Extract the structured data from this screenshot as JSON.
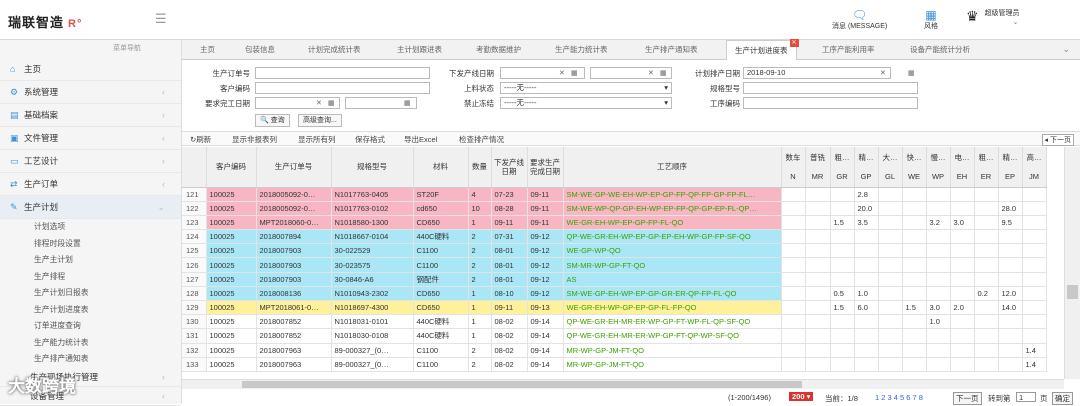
{
  "app": {
    "logo": "瑞联智造",
    "logo_mark": "R°"
  },
  "header": {
    "message": "消息 (MESSAGE)",
    "theme": "风格",
    "user": "超级管理员"
  },
  "sidebar": {
    "top_label": "菜单导航",
    "items": [
      {
        "label": "主页",
        "icon": "home-icon"
      },
      {
        "label": "系统管理",
        "icon": "gears-icon"
      },
      {
        "label": "基础档案",
        "icon": "archive-icon"
      },
      {
        "label": "文件管理",
        "icon": "file-icon"
      },
      {
        "label": "工艺设计",
        "icon": "design-icon"
      },
      {
        "label": "生产订单",
        "icon": "order-icon"
      },
      {
        "label": "生产计划",
        "icon": "plan-icon"
      }
    ],
    "sub_items": [
      "计划选项",
      "排程时段设置",
      "生产主计划",
      "生产排程",
      "生产计划日报表",
      "生产计划进度表",
      "订单进度查询",
      "生产能力统计表",
      "生产排产通知表"
    ],
    "bottom_items": [
      "生产现场执行管理",
      "设备管理"
    ],
    "watermark": "大数跨境"
  },
  "tabs": [
    "主页",
    "包装信息",
    "计划完成统计表",
    "主计划跟进表",
    "考勤数据维护",
    "生产能力统计表",
    "生产排产通知表",
    "生产计划进度表",
    "工序产能利用率",
    "设备产能统计分析"
  ],
  "form": {
    "order_no_label": "生产订单号",
    "customer_code_label": "客户编码",
    "required_date_label": "要求完工日期",
    "issue_date_label": "下发产线日期",
    "line_status_label": "上料状态",
    "line_status_value": "-----无-----",
    "forbid_label": "禁止冻结",
    "forbid_value": "-----无-----",
    "plan_date_label": "计划排产日期",
    "plan_date_value": "2018-09-10",
    "spec_label": "规格型号",
    "process_code_label": "工序编码",
    "query": "查询",
    "advanced": "高级查询..."
  },
  "toolbar": [
    "刷新",
    "显示非报表列",
    "显示所有列",
    "保存格式",
    "导出Excel",
    "检查排产情况"
  ],
  "toolbar_right": "下一页",
  "table": {
    "headers": [
      "客户编码",
      "生产订单号",
      "规格型号",
      "材料",
      "数量",
      "下发产线日期",
      "要求生产完成日期",
      "工艺顺序",
      "数车",
      "普铣",
      "粗…",
      "精…",
      "大…",
      "快…",
      "慢…",
      "电…",
      "粗…",
      "精…",
      "高…"
    ],
    "subheaders": [
      "",
      "",
      "",
      "",
      "",
      "",
      "",
      "",
      "N",
      "MR",
      "GR",
      "GP",
      "GL",
      "WE",
      "WP",
      "EH",
      "ER",
      "EP",
      "JM"
    ],
    "rows": [
      {
        "n": "121",
        "c": "pink",
        "cells": [
          "100025",
          "2018005092-0…",
          "N1017763-0405",
          "ST20F",
          "4",
          "07-23",
          "09-11",
          "SM-WE-GP-WE-EH-WP-EP-GP-FP-QP-FP-GP-FP-FL…",
          "",
          "",
          "",
          "2.8",
          "",
          "",
          "",
          "",
          "",
          "",
          ""
        ]
      },
      {
        "n": "122",
        "c": "pink",
        "cells": [
          "100025",
          "2018005092-0…",
          "N1017763-0102",
          "cd650",
          "10",
          "08-28",
          "09-11",
          "SM-WE-WP-QP-GP-EH-WP-EP-FP-QP-GP-EP-FL-QP…",
          "",
          "",
          "",
          "20.0",
          "",
          "",
          "",
          "",
          "",
          "28.0",
          ""
        ]
      },
      {
        "n": "123",
        "c": "pink",
        "cells": [
          "100025",
          "MPT2018060-0…",
          "N1018580-1300",
          "CD650",
          "1",
          "09-11",
          "09-11",
          "WE-GR-EH-WP-EP-GP-FP-FL-QO",
          "",
          "",
          "1.5",
          "3.5",
          "",
          "",
          "3.2",
          "3.0",
          "",
          "9.5",
          ""
        ]
      },
      {
        "n": "124",
        "c": "cyan",
        "cells": [
          "100025",
          "2018007894",
          "N1018667-0104",
          "440C硬料",
          "2",
          "07-31",
          "09-12",
          "QP-WE-GR-EH-WP-EP-GP-EP-EH-WP-GP-FP-SF-QO",
          "",
          "",
          "",
          "",
          "",
          "",
          "",
          "",
          "",
          "",
          ""
        ]
      },
      {
        "n": "125",
        "c": "cyan",
        "cells": [
          "100025",
          "2018007903",
          "30-022529",
          "C1100",
          "2",
          "08-01",
          "09-12",
          "WE-GP-WP-QO",
          "",
          "",
          "",
          "",
          "",
          "",
          "",
          "",
          "",
          "",
          ""
        ]
      },
      {
        "n": "126",
        "c": "cyan",
        "cells": [
          "100025",
          "2018007903",
          "30-023575",
          "C1100",
          "2",
          "08-01",
          "09-12",
          "SM-MR-WP-GP-FT-QO",
          "",
          "",
          "",
          "",
          "",
          "",
          "",
          "",
          "",
          "",
          ""
        ]
      },
      {
        "n": "127",
        "c": "cyan",
        "cells": [
          "100025",
          "2018007903",
          "30-0846-A6",
          "钢配件",
          "2",
          "08-01",
          "09-12",
          "AS",
          "",
          "",
          "",
          "",
          "",
          "",
          "",
          "",
          "",
          "",
          ""
        ]
      },
      {
        "n": "128",
        "c": "cyan",
        "cells": [
          "100025",
          "2018008136",
          "N1010943-2302",
          "CD650",
          "1",
          "08-10",
          "09-12",
          "SM-WE-GP-EH-WP-EP-GP-GR-ER-QP-FP-FL-QO",
          "",
          "",
          "0.5",
          "1.0",
          "",
          "",
          "",
          "",
          "0.2",
          "12.0",
          ""
        ]
      },
      {
        "n": "129",
        "c": "yellow",
        "cells": [
          "100025",
          "MPT2018061-0…",
          "N1018697-4300",
          "CD650",
          "1",
          "09-11",
          "09-13",
          "WE-GR-EH-WP-GP-EP-GP-FL-FP-QO",
          "",
          "",
          "1.5",
          "6.0",
          "",
          "1.5",
          "3.0",
          "2.0",
          "",
          "14.0",
          ""
        ]
      },
      {
        "n": "130",
        "c": "",
        "cells": [
          "100025",
          "2018007852",
          "N1018031-0101",
          "440C硬料",
          "1",
          "08-02",
          "09-14",
          "QP-WE-GR-EH-MR-ER-WP-GP-FT-WP-FL-QP-SF-QO",
          "",
          "",
          "",
          "",
          "",
          "",
          "1.0",
          "",
          "",
          "",
          ""
        ]
      },
      {
        "n": "131",
        "c": "",
        "cells": [
          "100025",
          "2018007852",
          "N1018030-0108",
          "440C硬料",
          "1",
          "08-02",
          "09-14",
          "QP-WE-GR-EH-MR-ER-WP-GP-FT-QP-WP-SF-QO",
          "",
          "",
          "",
          "",
          "",
          "",
          "",
          "",
          "",
          "",
          ""
        ]
      },
      {
        "n": "132",
        "c": "",
        "cells": [
          "100025",
          "2018007963",
          "89-000327_(0…",
          "C1100",
          "2",
          "08-02",
          "09-14",
          "MR-WP-GP-JM-FT-QO",
          "",
          "",
          "",
          "",
          "",
          "",
          "",
          "",
          "",
          "",
          "1.4"
        ]
      },
      {
        "n": "133",
        "c": "",
        "cells": [
          "100025",
          "2018007963",
          "89-000327_(0…",
          "C1100",
          "2",
          "08-02",
          "09-14",
          "MR-WP-GP-JM-FT-QO",
          "",
          "",
          "",
          "",
          "",
          "",
          "",
          "",
          "",
          "",
          "1.4"
        ]
      }
    ]
  },
  "pager": {
    "range": "(1-200/1496)",
    "size": "200",
    "current": "当前：1/8",
    "pages": "1 2 3 4 5 6 7 8",
    "next": "下一页",
    "goto_label": "转到第",
    "goto_value": "1",
    "unit": "页",
    "ok": "确定"
  }
}
